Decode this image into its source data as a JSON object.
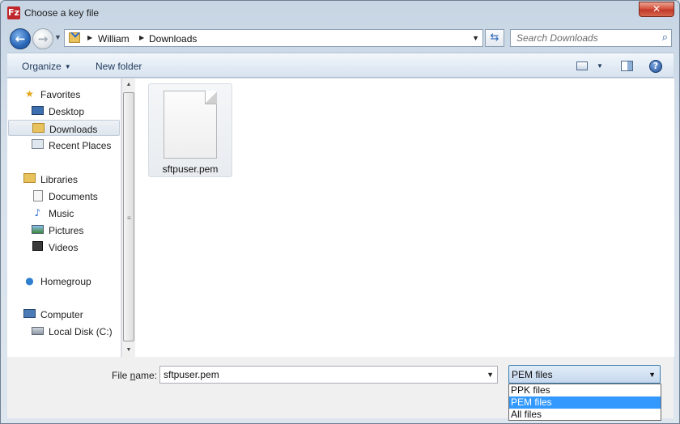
{
  "window": {
    "title": "Choose a key file",
    "app_icon_glyph": "Fz",
    "close_glyph": "✕"
  },
  "address": {
    "breadcrumb": [
      "William",
      "Downloads"
    ]
  },
  "search": {
    "placeholder": "Search Downloads"
  },
  "toolbar": {
    "organize_label": "Organize",
    "new_folder_label": "New folder"
  },
  "nav": {
    "favorites": {
      "label": "Favorites",
      "items": [
        {
          "label": "Desktop"
        },
        {
          "label": "Downloads",
          "selected": true
        },
        {
          "label": "Recent Places"
        }
      ]
    },
    "libraries": {
      "label": "Libraries",
      "items": [
        {
          "label": "Documents"
        },
        {
          "label": "Music"
        },
        {
          "label": "Pictures"
        },
        {
          "label": "Videos"
        }
      ]
    },
    "homegroup": {
      "label": "Homegroup"
    },
    "computer": {
      "label": "Computer",
      "items": [
        {
          "label": "Local Disk (C:)"
        }
      ]
    }
  },
  "files": [
    {
      "name": "sftpuser.pem",
      "icon": "document-icon"
    }
  ],
  "bottom": {
    "file_name_label_pre": "File ",
    "file_name_label_accel": "n",
    "file_name_label_post": "ame:",
    "file_name_value": "sftpuser.pem",
    "file_type_selected": "PEM files",
    "file_type_options": [
      {
        "label": "PPK files"
      },
      {
        "label": "PEM files",
        "highlighted": true
      },
      {
        "label": "All files"
      }
    ]
  },
  "colors": {
    "selection_blue": "#3399ff",
    "link_blue": "#1e395b",
    "close_red": "#c0392b"
  }
}
